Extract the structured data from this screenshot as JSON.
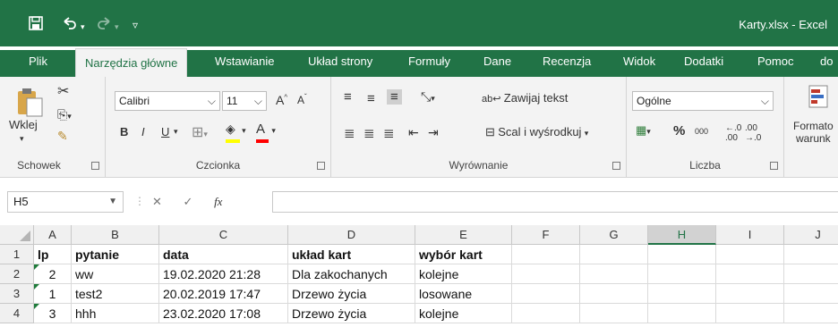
{
  "window": {
    "title": "Karty.xlsx  -  Excel"
  },
  "ribbon_tabs": [
    {
      "label": "Plik"
    },
    {
      "label": "Narzędzia główne"
    },
    {
      "label": "Wstawianie"
    },
    {
      "label": "Układ strony"
    },
    {
      "label": "Formuły"
    },
    {
      "label": "Dane"
    },
    {
      "label": "Recenzja"
    },
    {
      "label": "Widok"
    },
    {
      "label": "Dodatki"
    },
    {
      "label": "Pomoc"
    },
    {
      "label": "do"
    }
  ],
  "clipboard": {
    "paste_label": "Wklej",
    "group_name": "Schowek"
  },
  "font": {
    "name": "Calibri",
    "size": "11",
    "bold": "B",
    "italic": "I",
    "underline": "U",
    "grow": "A",
    "shrink": "A",
    "color_letter": "A",
    "group_name": "Czcionka",
    "font_color": "#ff0000",
    "fill_color": "#ffff00"
  },
  "alignment": {
    "wrap_text": "Zawijaj tekst",
    "merge_center": "Scal i wyśrodkuj",
    "group_name": "Wyrównanie"
  },
  "number": {
    "format": "Ogólne",
    "percent": "%",
    "thousands": "000",
    "group_name": "Liczba"
  },
  "styles": {
    "conditional_line1": "Formato",
    "conditional_line2": "warunk"
  },
  "formula_bar": {
    "name_box": "H5",
    "fx": "fx",
    "value": ""
  },
  "grid": {
    "columns": [
      "A",
      "B",
      "C",
      "D",
      "E",
      "F",
      "G",
      "H",
      "I",
      "J"
    ],
    "selected_column": "H",
    "rows": [
      {
        "num": "1",
        "cells": [
          "lp",
          "pytanie",
          "data",
          "układ kart",
          "wybór kart",
          "",
          "",
          "",
          "",
          ""
        ]
      },
      {
        "num": "2",
        "cells": [
          "2",
          "ww",
          "19.02.2020 21:28",
          "Dla zakochanych",
          "kolejne",
          "",
          "",
          "",
          "",
          ""
        ]
      },
      {
        "num": "3",
        "cells": [
          "1",
          "test2",
          "20.02.2019 17:47",
          "Drzewo życia",
          "losowane",
          "",
          "",
          "",
          "",
          ""
        ]
      },
      {
        "num": "4",
        "cells": [
          "3",
          "hhh",
          "23.02.2020 17:08",
          "Drzewo życia",
          "kolejne",
          "",
          "",
          "",
          "",
          ""
        ]
      }
    ]
  },
  "colors": {
    "accent": "#217346"
  }
}
